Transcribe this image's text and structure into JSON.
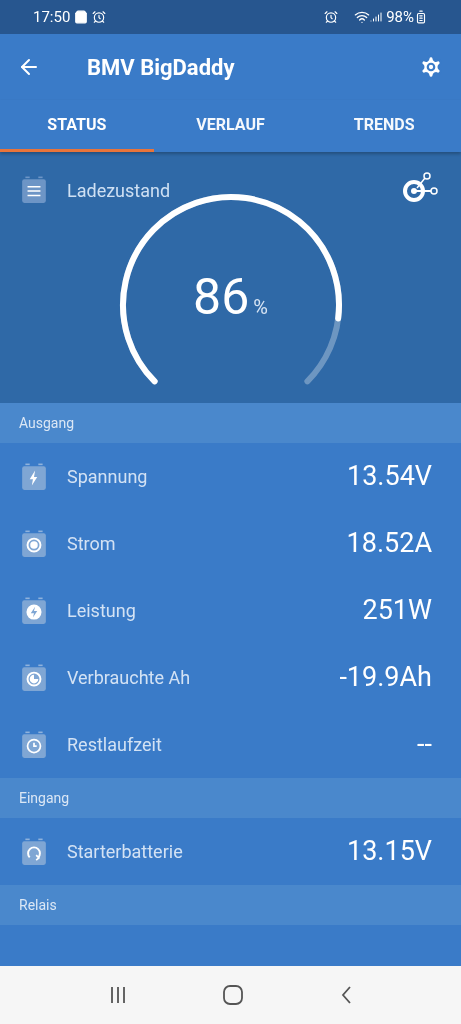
{
  "status_bar": {
    "time": "17:50",
    "battery": "98%"
  },
  "app_bar": {
    "title": "BMV BigDaddy"
  },
  "tabs": [
    {
      "label": "STATUS",
      "selected": true
    },
    {
      "label": "VERLAUF",
      "selected": false
    },
    {
      "label": "TRENDS",
      "selected": false
    }
  ],
  "gauge": {
    "title": "Ladezustand",
    "value": "86",
    "unit": "%"
  },
  "sections": [
    {
      "title": "Ausgang",
      "rows": [
        {
          "kind": "bolt",
          "label": "Spannung",
          "value": "13.54V"
        },
        {
          "kind": "dot",
          "label": "Strom",
          "value": "18.52A"
        },
        {
          "kind": "power",
          "label": "Leistung",
          "value": "251W"
        },
        {
          "kind": "consumed",
          "label": "Verbrauchte Ah",
          "value": "-19.9Ah"
        },
        {
          "kind": "clock",
          "label": "Restlaufzeit",
          "value": "--"
        }
      ]
    },
    {
      "title": "Eingang",
      "rows": [
        {
          "kind": "loop",
          "label": "Starterbatterie",
          "value": "13.15V"
        }
      ]
    },
    {
      "title": "Relais"
    }
  ]
}
